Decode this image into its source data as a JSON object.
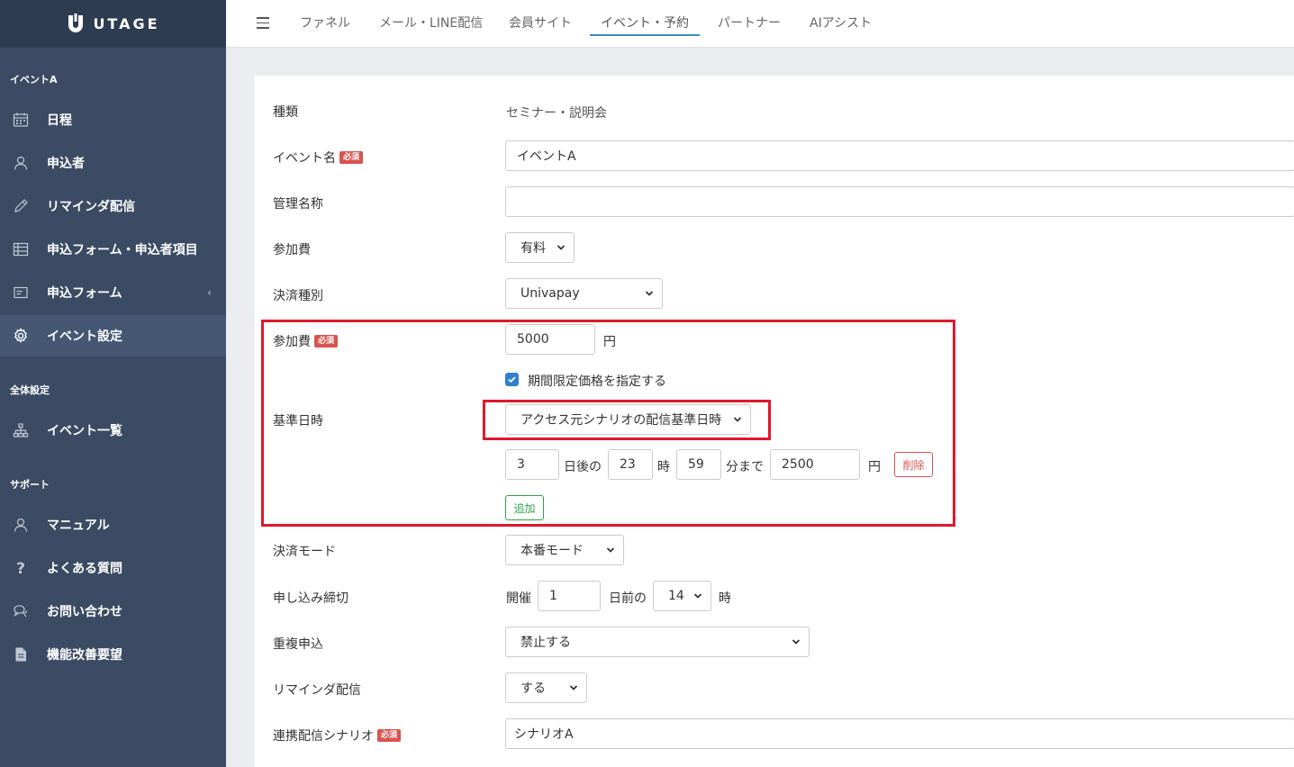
{
  "app": {
    "logo_text": "UTAGE"
  },
  "sidebar": {
    "section_event": "イベントA",
    "event_items": [
      {
        "label": "日程"
      },
      {
        "label": "申込者"
      },
      {
        "label": "リマインダ配信"
      },
      {
        "label": "申込フォーム・申込者項目"
      },
      {
        "label": "申込フォーム"
      },
      {
        "label": "イベント設定"
      }
    ],
    "section_global": "全体設定",
    "global_items": [
      {
        "label": "イベント一覧"
      }
    ],
    "section_support": "サポート",
    "support_items": [
      {
        "label": "マニュアル"
      },
      {
        "label": "よくある質問"
      },
      {
        "label": "お問い合わせ"
      },
      {
        "label": "機能改善要望"
      }
    ],
    "chevron": "‹"
  },
  "topnav": {
    "tabs": [
      {
        "label": "ファネル"
      },
      {
        "label": "メール・LINE配信"
      },
      {
        "label": "会員サイト"
      },
      {
        "label": "イベント・予約"
      },
      {
        "label": "パートナー"
      },
      {
        "label": "AIアシスト"
      }
    ],
    "active_tab": "イベント・予約"
  },
  "form": {
    "required_badge": "必須",
    "type": {
      "label": "種類",
      "value": "セミナー・説明会"
    },
    "event_name": {
      "label": "イベント名",
      "value": "イベントA"
    },
    "admin_name": {
      "label": "管理名称",
      "value": ""
    },
    "fee_type": {
      "label": "参加費",
      "value": "有料"
    },
    "payment_type": {
      "label": "決済種別",
      "value": "Univapay"
    },
    "fee_amount": {
      "label": "参加費",
      "value": "5000",
      "unit": "円"
    },
    "limited_price": {
      "label": "期間限定価格を指定する",
      "checked": true
    },
    "base_datetime": {
      "label": "基準日時",
      "value": "アクセス元シナリオの配信基準日時"
    },
    "limited_row": {
      "days": "3",
      "days_suffix": "日後の",
      "hour": "23",
      "hour_suffix": "時",
      "minute": "59",
      "minute_suffix": "分まで",
      "price": "2500",
      "price_unit": "円",
      "delete_label": "削除"
    },
    "add_label": "追加",
    "payment_mode": {
      "label": "決済モード",
      "value": "本番モード"
    },
    "deadline": {
      "label": "申し込み締切",
      "prefix": "開催",
      "days": "1",
      "days_suffix": "日前の",
      "hour": "14",
      "hour_suffix": "時"
    },
    "duplicate": {
      "label": "重複申込",
      "value": "禁止する"
    },
    "reminder": {
      "label": "リマインダ配信",
      "value": "する"
    },
    "scenario": {
      "label": "連携配信シナリオ",
      "value": "シナリオA"
    }
  },
  "colors": {
    "sidebar_bg": "#3b4b63",
    "highlight": "#e0182d",
    "required": "#d9534f",
    "checkbox": "#2f80d1",
    "add_button": "#28a745"
  }
}
